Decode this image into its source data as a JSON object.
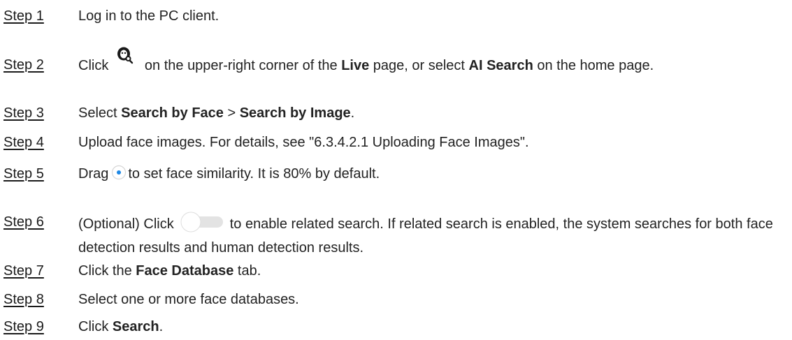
{
  "steps": [
    {
      "label": "Step 1",
      "text": "Log in to the PC client."
    },
    {
      "label": "Step 2",
      "t1": "Click",
      "t2": " on the upper-right corner of the ",
      "b1": "Live",
      "t3": " page, or select ",
      "b2": "AI Search",
      "t4": " on the home page."
    },
    {
      "label": "Step 3",
      "t1": "Select ",
      "b1": "Search by Face",
      "t2": " > ",
      "b2": "Search by Image",
      "t3": "."
    },
    {
      "label": "Step 4",
      "text": "Upload face images. For details, see \"6.3.4.2.1 Uploading Face Images\"."
    },
    {
      "label": "Step 5",
      "t1": "Drag",
      "t2": "to set face similarity. It is 80% by default."
    },
    {
      "label": "Step 6",
      "t1": "(Optional) Click",
      "t2": "to enable related search. If related search is enabled, the system searches for both face detection results and human detection results."
    },
    {
      "label": "Step 7",
      "t1": "Click the ",
      "b1": "Face Database",
      "t2": " tab."
    },
    {
      "label": "Step 8",
      "text": "Select one or more face databases."
    },
    {
      "label": "Step 9",
      "t1": "Click ",
      "b1": "Search",
      "t2": "."
    }
  ],
  "icons": {
    "step2": "face-search-icon",
    "step5": "slider-handle-icon",
    "step6": "toggle-switch-icon"
  },
  "colors": {
    "slider_handle": "#1e88e5",
    "toggle_track": "#e0e0e0"
  }
}
